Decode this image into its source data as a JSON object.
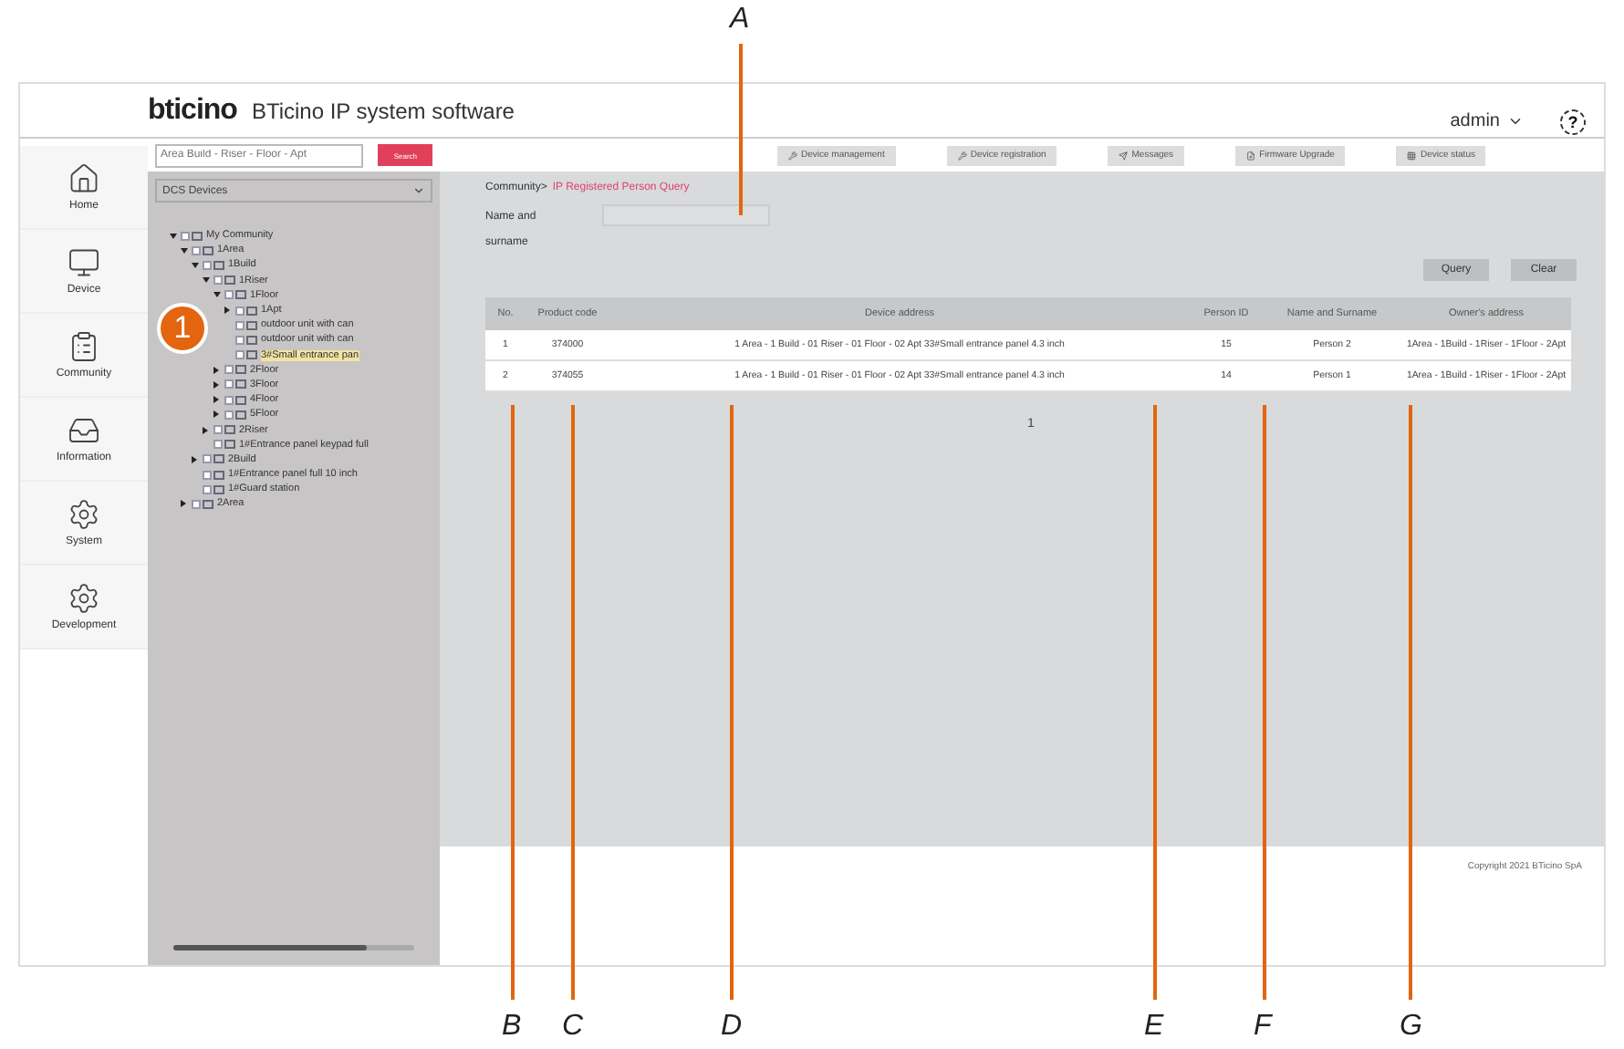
{
  "header": {
    "brand": "bticino",
    "title": "BTicino IP system software",
    "user": "admin",
    "help": "?"
  },
  "nav": [
    {
      "label": "Home",
      "selected": false
    },
    {
      "label": "Device",
      "selected": false
    },
    {
      "label": "Community",
      "selected": false
    },
    {
      "label": "Information",
      "selected": false
    },
    {
      "label": "System",
      "selected": false
    },
    {
      "label": "Development",
      "selected": false
    }
  ],
  "tree_panel": {
    "search": {
      "placeholder": "Area Build - Riser - Floor - Apt"
    },
    "search_button": "Search",
    "dropdown": "DCS Devices",
    "tree": [
      {
        "label": "My Community",
        "expanded": true,
        "checked": false,
        "selected": false,
        "children": [
          {
            "label": "1Area",
            "expanded": true,
            "checked": false,
            "selected": false,
            "children": [
              {
                "label": "1Build",
                "expanded": true,
                "checked": false,
                "selected": false,
                "children": [
                  {
                    "label": "1Riser",
                    "expanded": true,
                    "checked": false,
                    "selected": false,
                    "children": [
                      {
                        "label": "1Floor",
                        "expanded": true,
                        "checked": false,
                        "selected": false,
                        "children": [
                          {
                            "label": "1Apt",
                            "expanded": false,
                            "checked": false,
                            "selected": false
                          },
                          {
                            "label": "outdoor unit with can",
                            "checked": false,
                            "selected": false
                          },
                          {
                            "label": "outdoor unit with can",
                            "checked": false,
                            "selected": false
                          },
                          {
                            "label": "3#Small entrance pan",
                            "checked": false,
                            "selected": true
                          }
                        ]
                      },
                      {
                        "label": "2Floor",
                        "expanded": false,
                        "checked": false,
                        "selected": false
                      },
                      {
                        "label": "3Floor",
                        "expanded": false,
                        "checked": false,
                        "selected": false
                      },
                      {
                        "label": "4Floor",
                        "expanded": false,
                        "checked": false,
                        "selected": false
                      },
                      {
                        "label": "5Floor",
                        "expanded": false,
                        "checked": false,
                        "selected": false
                      }
                    ]
                  },
                  {
                    "label": "2Riser",
                    "expanded": false,
                    "checked": false,
                    "selected": false
                  },
                  {
                    "label": "1#Entrance panel keypad full",
                    "checked": false,
                    "selected": false
                  }
                ]
              },
              {
                "label": "2Build",
                "expanded": false,
                "checked": false,
                "selected": false
              },
              {
                "label": "1#Entrance panel full 10 inch",
                "checked": false,
                "selected": false
              },
              {
                "label": "1#Guard station",
                "checked": false,
                "selected": false
              }
            ]
          },
          {
            "label": "2Area",
            "expanded": false,
            "checked": false,
            "selected": false
          }
        ]
      }
    ]
  },
  "toolbar": [
    "Device management",
    "Device registration",
    "Messages",
    "Firmware Upgrade",
    "Device status"
  ],
  "breadcrumb": {
    "parent": "Community>",
    "current": "IP Registered Person Query"
  },
  "filter": {
    "label": "Name and surname"
  },
  "actions": [
    "Query",
    "Clear"
  ],
  "table": {
    "columns": [
      "No.",
      "Product code",
      "Device address",
      "Person ID",
      "Name and Surname",
      "Owner's address"
    ],
    "rows": [
      [
        "1",
        "374000",
        "1 Area - 1 Build - 01 Riser - 01 Floor - 02 Apt 33#Small entrance panel 4.3 inch",
        "15",
        "Person 2",
        "1Area - 1Build - 1Riser - 1Floor - 2Apt"
      ],
      [
        "2",
        "374055",
        "1 Area - 1 Build - 01 Riser - 01 Floor - 02 Apt 33#Small entrance panel 4.3 inch",
        "14",
        "Person 1",
        "1Area - 1Build - 1Riser - 1Floor - 2Apt"
      ]
    ]
  },
  "pagination": "1",
  "footer": "Copyright 2021 BTicino SpA",
  "callouts": {
    "badge": "1",
    "letters": [
      "A",
      "B",
      "C",
      "D",
      "E",
      "F",
      "G"
    ]
  }
}
